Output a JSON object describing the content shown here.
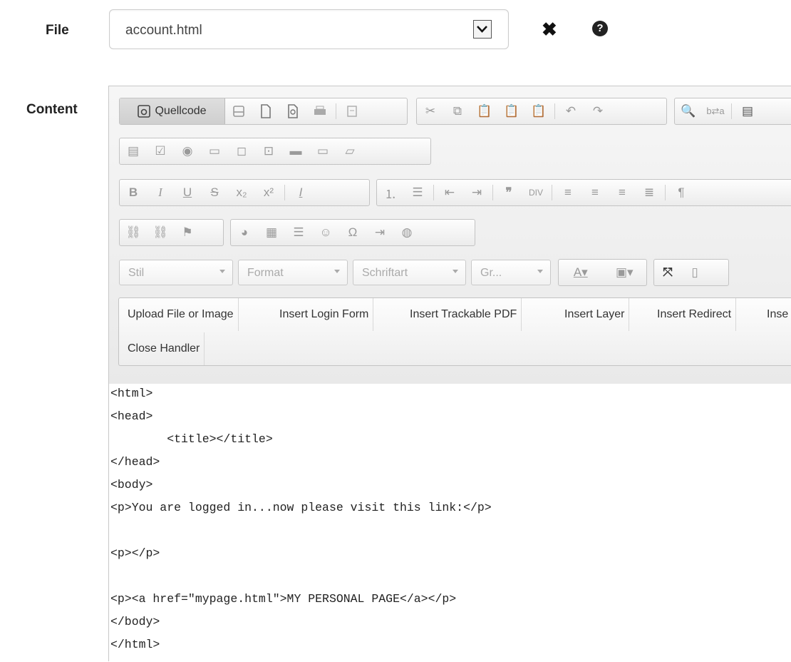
{
  "form": {
    "file_label": "File",
    "file_value": "account.html",
    "content_label": "Content"
  },
  "icons": {
    "remove": "close-icon",
    "help": "question-circle-icon",
    "help_glyph": "?"
  },
  "toolbar": {
    "source_label": "Quellcode",
    "style_combo": "Stil",
    "format_combo": "Format",
    "font_combo": "Schriftart",
    "size_combo": "Gr..."
  },
  "plugins": {
    "upload": "Upload File or Image",
    "login_form": "Insert Login Form",
    "trackable_pdf": "Insert Trackable PDF",
    "layer": "Insert Layer",
    "redirect": "Insert Redirect",
    "truncated": "Inse",
    "close_handler": "Close Handler"
  },
  "source_lines": [
    "<html>",
    "<head>",
    "        <title></title>",
    "</head>",
    "<body>",
    "<p>You are logged in...now please visit this link:</p>",
    "",
    "<p></p>",
    "",
    "<p><a href=\"mypage.html\">MY PERSONAL PAGE</a></p>",
    "</body>",
    "</html>"
  ]
}
